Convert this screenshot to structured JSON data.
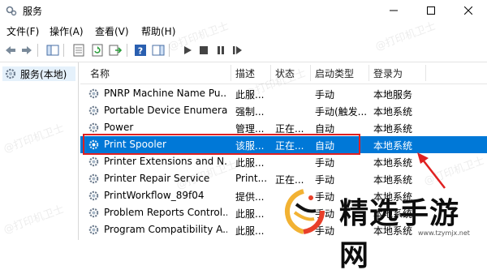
{
  "window": {
    "title": "服务"
  },
  "menu": {
    "items": [
      "文件(F)",
      "操作(A)",
      "查看(V)",
      "帮助(H)"
    ]
  },
  "tree": {
    "root_label": "服务(本地)"
  },
  "columns": {
    "name": "名称",
    "desc": "描述",
    "status": "状态",
    "startup": "启动类型",
    "logon": "登录为"
  },
  "services": [
    {
      "name": "PNRP Machine Name Pu...",
      "desc": "此服...",
      "status": "",
      "startup": "手动",
      "logon": "本地服务"
    },
    {
      "name": "Portable Device Enumera...",
      "desc": "强制...",
      "status": "",
      "startup": "手动(触发...",
      "logon": "本地系统"
    },
    {
      "name": "Power",
      "desc": "管理...",
      "status": "正在...",
      "startup": "自动",
      "logon": "本地系统"
    },
    {
      "name": "Print Spooler",
      "desc": "该服...",
      "status": "正在...",
      "startup": "自动",
      "logon": "本地系统",
      "selected": true
    },
    {
      "name": "Printer Extensions and N...",
      "desc": "此服...",
      "status": "",
      "startup": "手动",
      "logon": "本地系统"
    },
    {
      "name": "Printer Repair Service",
      "desc": "Print...",
      "status": "正在...",
      "startup": "手动",
      "logon": "本地系统"
    },
    {
      "name": "PrintWorkflow_89f04",
      "desc": "提供...",
      "status": "",
      "startup": "手动",
      "logon": "本地系统"
    },
    {
      "name": "Problem Reports Control...",
      "desc": "此服...",
      "status": "",
      "startup": "手动",
      "logon": "本地系统"
    },
    {
      "name": "Program Compatibility A...",
      "desc": "此服...",
      "status": "",
      "startup": "手动",
      "logon": "本地系统"
    }
  ],
  "watermark": {
    "text": "@打印机卫士"
  },
  "overlay": {
    "brand": "精选手游网",
    "url": "www.tzymjx.net"
  },
  "colors": {
    "selection": "#0078d7",
    "highlight_box": "#e02020",
    "arrow": "#e02020"
  }
}
